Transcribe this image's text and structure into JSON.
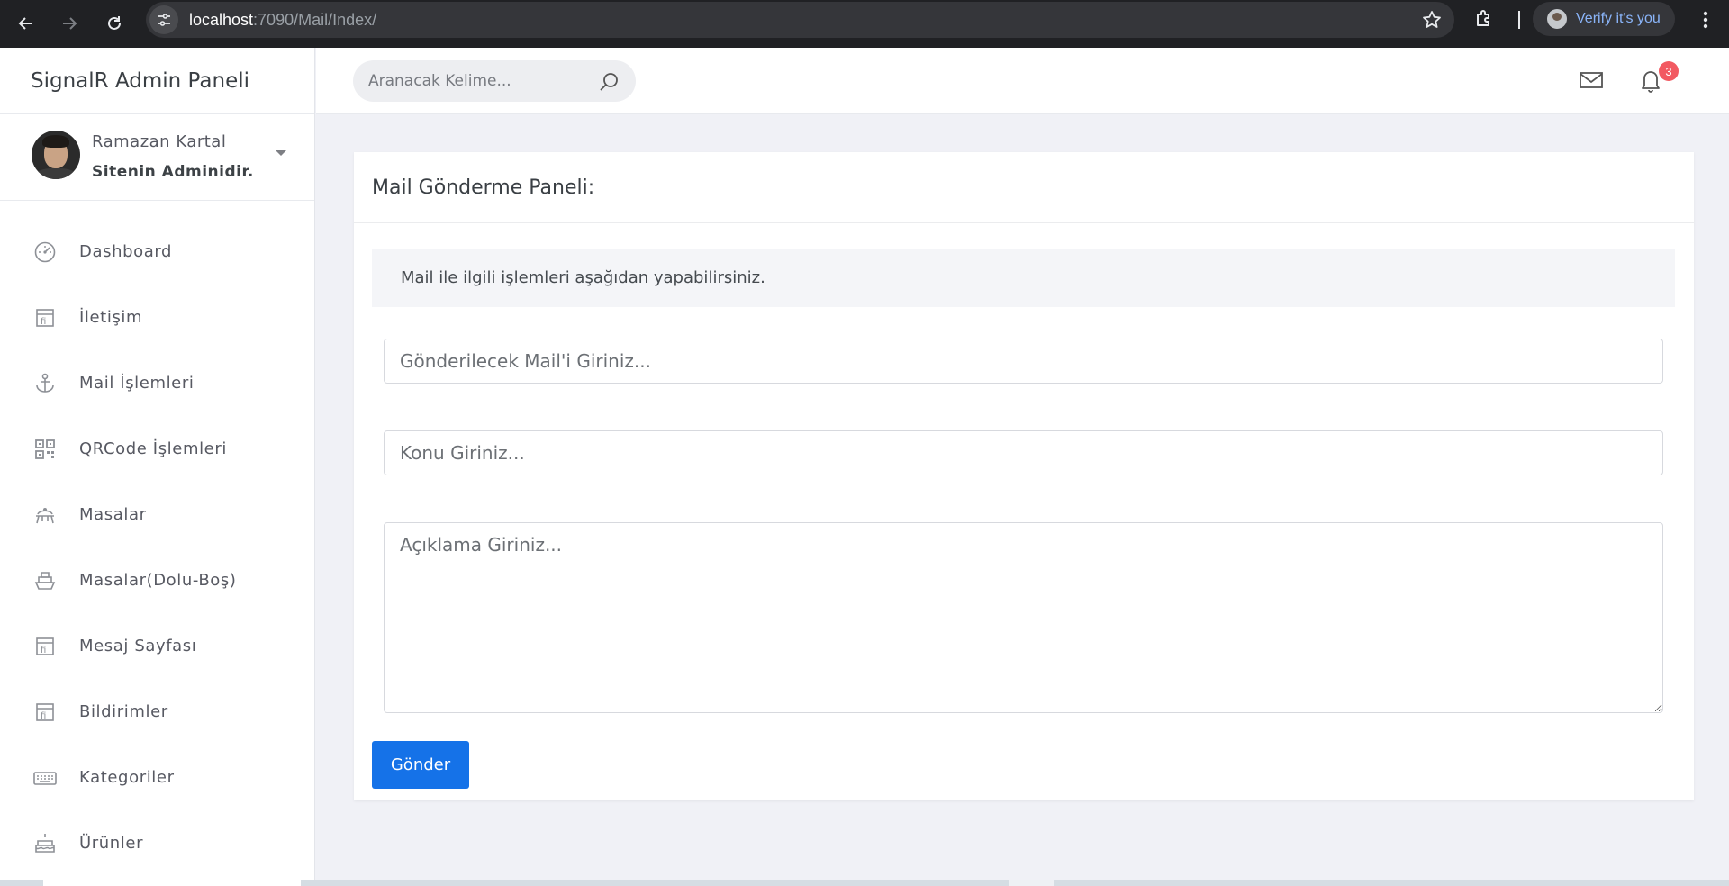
{
  "browser": {
    "url_host": "localhost",
    "url_path": ":7090/Mail/Index/",
    "profile_label": "Verify it's you"
  },
  "sidebar": {
    "brand": "SignalR Admin Paneli",
    "user": {
      "name": "Ramazan Kartal",
      "role": "Sitenin Adminidir."
    },
    "items": [
      {
        "label": "Dashboard",
        "icon": "speedometer-icon"
      },
      {
        "label": "İletişim",
        "icon": "document-icon"
      },
      {
        "label": "Mail İşlemleri",
        "icon": "anchor-icon"
      },
      {
        "label": "QRCode İşlemleri",
        "icon": "qrcode-icon"
      },
      {
        "label": "Masalar",
        "icon": "table-icon"
      },
      {
        "label": "Masalar(Dolu-Boş)",
        "icon": "ship-icon"
      },
      {
        "label": "Mesaj Sayfası",
        "icon": "document-icon"
      },
      {
        "label": "Bildirimler",
        "icon": "document-icon"
      },
      {
        "label": "Kategoriler",
        "icon": "keyboard-icon"
      },
      {
        "label": "Ürünler",
        "icon": "cake-icon"
      }
    ]
  },
  "topbar": {
    "search_placeholder": "Aranacak Kelime...",
    "notification_count": "3"
  },
  "card": {
    "title": "Mail Gönderme Paneli:",
    "info": "Mail ile ilgili işlemleri aşağıdan yapabilirsiniz.",
    "mail_placeholder": "Gönderilecek Mail'i Giriniz...",
    "subject_placeholder": "Konu Giriniz...",
    "description_placeholder": "Açıklama Giriniz...",
    "send_label": "Gönder"
  },
  "colors": {
    "primary": "#1572e8",
    "badge": "#f25961",
    "background": "#f0f1f6"
  }
}
